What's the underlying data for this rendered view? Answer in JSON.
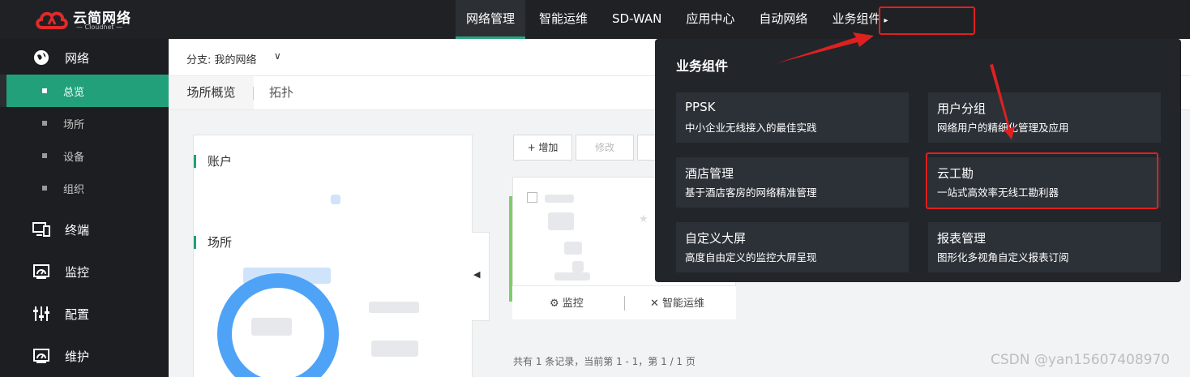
{
  "brand": {
    "name": "云简网络",
    "sub": "— Cloudnet —"
  },
  "top_nav": [
    {
      "label": "网络管理",
      "active": true
    },
    {
      "label": "智能运维"
    },
    {
      "label": "SD-WAN"
    },
    {
      "label": "应用中心"
    },
    {
      "label": "自动网络"
    },
    {
      "label": "业务组件",
      "caret": "▸"
    }
  ],
  "sidebar": {
    "groups": [
      {
        "label": "网络",
        "icon": "globe-icon"
      },
      {
        "label": "终端",
        "icon": "monitor-icon"
      },
      {
        "label": "监控",
        "icon": "gauge-icon"
      },
      {
        "label": "配置",
        "icon": "sliders-icon"
      },
      {
        "label": "维护",
        "icon": "gauge-icon"
      }
    ],
    "sub_items": [
      {
        "label": "总览",
        "active": true
      },
      {
        "label": "场所"
      },
      {
        "label": "设备"
      },
      {
        "label": "组织"
      }
    ]
  },
  "branch": {
    "label": "分支: 我的网络",
    "chevron": "∨"
  },
  "tabs": [
    {
      "label": "场所概览",
      "active": true
    },
    {
      "label": "拓扑"
    }
  ],
  "overview": {
    "account_title": "账户",
    "site_title": "场所"
  },
  "toolbar": {
    "add_label": "+ 增加",
    "edit_label": "修改"
  },
  "card": {
    "monitor_label": "监控",
    "ops_label": "智能运维"
  },
  "pager_text": "共有 1 条记录，当前第 1 - 1，第 1 / 1 页",
  "dropdown": {
    "title": "业务组件",
    "items": [
      {
        "name": "PPSK",
        "desc": "中小企业无线接入的最佳实践"
      },
      {
        "name": "用户分组",
        "desc": "网络用户的精细化管理及应用"
      },
      {
        "name": "酒店管理",
        "desc": "基于酒店客房的网络精准管理"
      },
      {
        "name": "云工勘",
        "desc": "一站式高效率无线工勘利器"
      },
      {
        "name": "自定义大屏",
        "desc": "高度自由定义的监控大屏呈现"
      },
      {
        "name": "报表管理",
        "desc": "图形化多视角自定义报表订阅"
      }
    ]
  },
  "watermark": "CSDN @yan15607408970",
  "colors": {
    "accent_green": "#22a07a",
    "highlight_red": "#e02020",
    "ring_blue": "#4fa3f7"
  }
}
